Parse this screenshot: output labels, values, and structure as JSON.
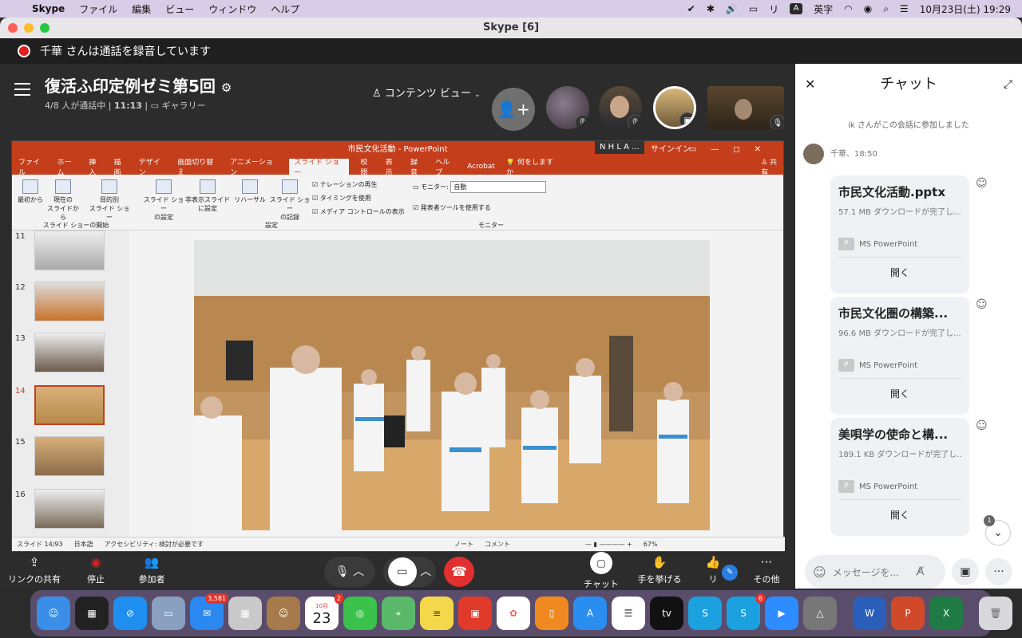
{
  "menubar": {
    "app": "Skype",
    "items": [
      "ファイル",
      "編集",
      "ビュー",
      "ウィンドウ",
      "ヘルプ"
    ],
    "ime": "A",
    "ime_label": "英字",
    "lang_char": "リ",
    "datetime": "10月23日(土)  19:29"
  },
  "window": {
    "title": "Skype [6]"
  },
  "recording": {
    "text": "千華 さんは通話を録音しています"
  },
  "meeting": {
    "title": "復活ふ印定例ゼミ第5回",
    "status": "4/8 人が通話中 |",
    "duration": "11:13",
    "layout": "ギャラリー",
    "content_view": "コンテンツ ビュー"
  },
  "powerpoint": {
    "title": "市民文化活動  -  PowerPoint",
    "presenter_tag": "N H L A ...",
    "signin": "サインイン",
    "tabs": [
      "ファイル",
      "ホーム",
      "挿入",
      "描画",
      "デザイン",
      "画面切り替え",
      "アニメーション",
      "スライド ショー",
      "校閲",
      "表示",
      "録音",
      "ヘルプ",
      "Acrobat",
      "何をしますか"
    ],
    "share": "共有",
    "ribbon": {
      "from_start": "最初から",
      "from_current": "現在の\nスライドから",
      "custom": "目的別\nスライド ショー",
      "group1": "スライド ショーの開始",
      "setup": "スライド ショー\nの設定",
      "hide": "非表示スライド\nに設定",
      "rehearse": "リハーサル",
      "record": "スライド ショー\nの記録",
      "narration": "ナレーションの再生",
      "timing": "タイミングを使用",
      "media": "メディア コントロールの表示",
      "group2": "設定",
      "monitor_label": "モニター:",
      "monitor_value": "自動",
      "presenter_view": "発表者ツールを使用する",
      "group3": "モニター"
    },
    "thumbs": [
      "11",
      "12",
      "13",
      "14",
      "15",
      "16"
    ],
    "status": {
      "slide": "スライド 14/93",
      "lang": "日本語",
      "access": "アクセシビリティ: 検討が必要です",
      "notes": "ノート",
      "comments": "コメント",
      "zoom": "67%"
    }
  },
  "controls": {
    "share_link": "リンクの共有",
    "stop": "停止",
    "participants": "参加者",
    "chat": "チャット",
    "raise": "手を挙げる",
    "react": "リ",
    "more": "その他"
  },
  "chat": {
    "title": "チャット",
    "system": "ik さんがこの会話に参加しました",
    "sender": "千華、18:50",
    "files": [
      {
        "name": "市民文化活動.pptx",
        "size": "57.1 MB ダウンロードが完了し...",
        "app": "MS PowerPoint",
        "open": "開く"
      },
      {
        "name": "市民文化圏の構築...",
        "size": "96.6 MB ダウンロードが完了し...",
        "app": "MS PowerPoint",
        "open": "開く"
      },
      {
        "name": "美唄学の使命と構...",
        "size": "189.1 KB ダウンロードが完了し...",
        "app": "MS PowerPoint",
        "open": "開く"
      }
    ],
    "unread": "1",
    "placeholder": "メッセージを..."
  },
  "dock": {
    "mail_badge": "3,581",
    "cal_month": "10月",
    "cal_day": "23",
    "cal_badge": "2",
    "skype_badge": "6"
  }
}
